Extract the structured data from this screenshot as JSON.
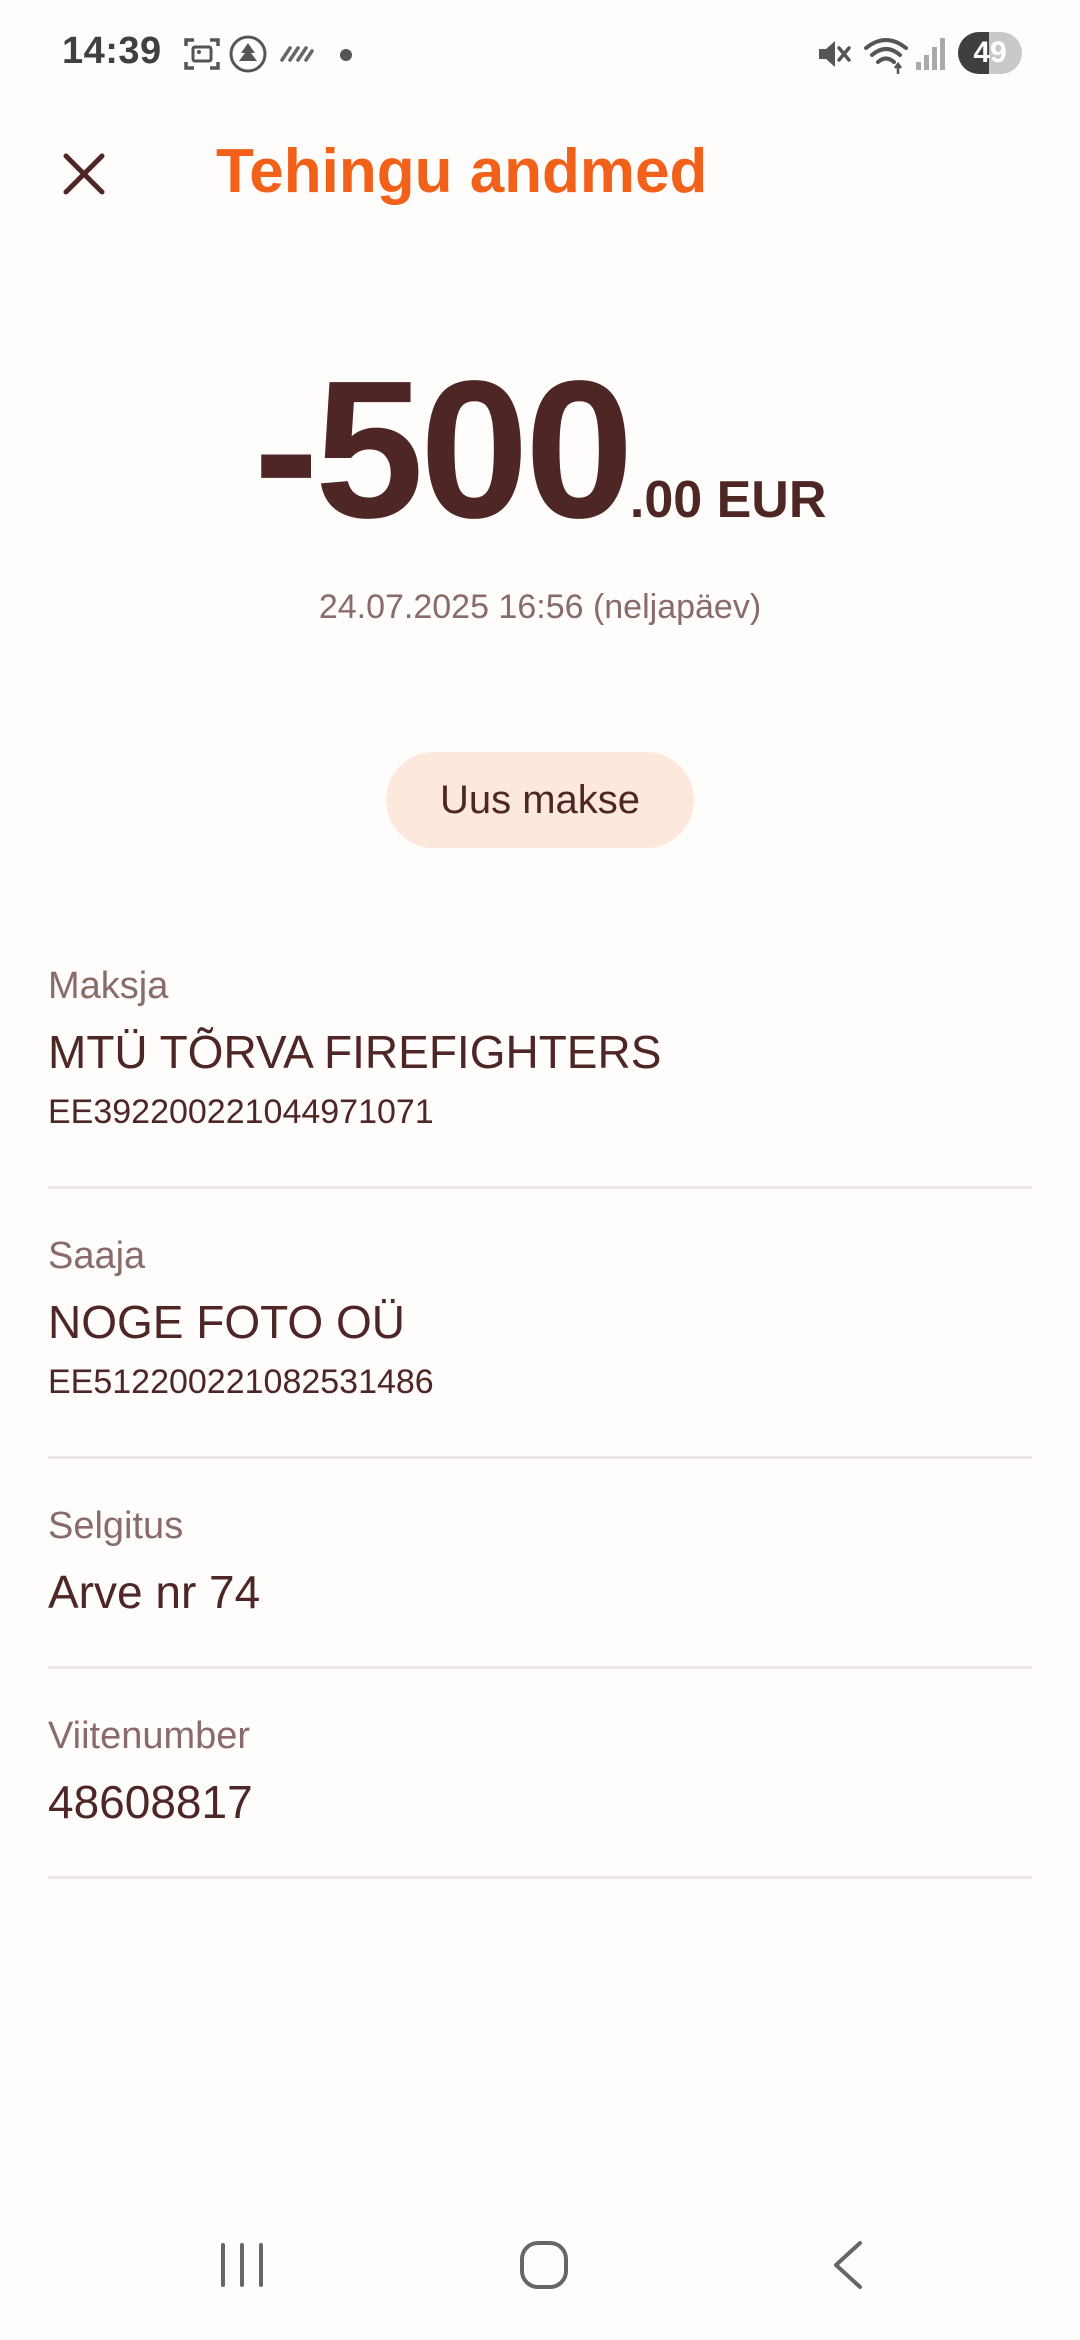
{
  "status_bar": {
    "time": "14:39",
    "battery_level": "49",
    "icons": [
      "screenshot-icon",
      "app-notification-icon",
      "weather-icon",
      "dot-icon",
      "mute-icon",
      "wifi-icon",
      "signal-icon",
      "battery-icon"
    ]
  },
  "header": {
    "title": "Tehingu andmed",
    "close_icon": "close-icon"
  },
  "transaction": {
    "amount_major": "-500",
    "amount_minor": ".00 EUR",
    "date": "24.07.2025 16:56 (neljapäev)"
  },
  "actions": {
    "new_payment_label": "Uus makse"
  },
  "details": {
    "payer": {
      "label": "Maksja",
      "name": "MTÜ TÕRVA FIREFIGHTERS",
      "account": "EE392200221044971071"
    },
    "recipient": {
      "label": "Saaja",
      "name": "NOGE FOTO OÜ",
      "account": "EE512200221082531486"
    },
    "description": {
      "label": "Selgitus",
      "value": "Arve nr 74"
    },
    "reference": {
      "label": "Viitenumber",
      "value": "48608817"
    }
  },
  "nav_bar": {
    "icons": [
      "recent-apps-icon",
      "home-icon",
      "back-icon"
    ]
  },
  "colors": {
    "accent": "#f2611a",
    "text_primary": "#4e2626",
    "text_secondary": "#8a6b6b",
    "button_bg": "#fde8dc",
    "divider": "#eee6e4"
  }
}
